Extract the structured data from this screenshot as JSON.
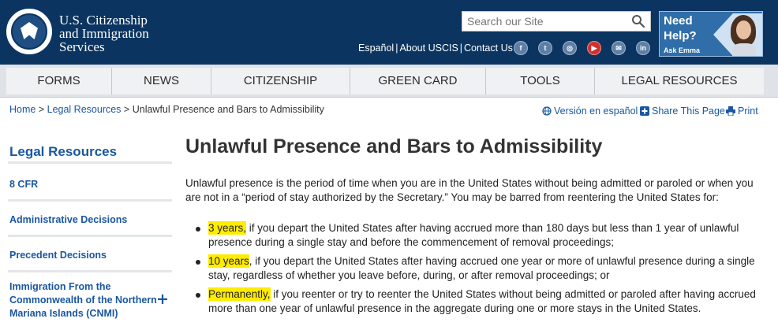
{
  "header": {
    "agency_line1": "U.S. Citizenship",
    "agency_line2": "and Immigration",
    "agency_line3": "Services",
    "search_placeholder": "Search our Site",
    "util_links": [
      "Español",
      "About USCIS",
      "Contact Us"
    ],
    "util_separator": "|",
    "social_icons": [
      "facebook-icon",
      "twitter-icon",
      "instagram-icon",
      "youtube-icon",
      "email-icon",
      "linkedin-icon"
    ],
    "need_help_line1": "Need",
    "need_help_line2": "Help?",
    "ask_emma": "Ask Emma"
  },
  "nav": {
    "items": [
      "FORMS",
      "NEWS",
      "CITIZENSHIP",
      "GREEN CARD",
      "TOOLS",
      "LEGAL RESOURCES"
    ]
  },
  "breadcrumb": {
    "home": "Home",
    "sep": ">",
    "legal": "Legal Resources",
    "current": "Unlawful Presence and Bars to Admissibility"
  },
  "page_tools": {
    "spanish": "Versión en español",
    "share": "Share This Page",
    "print": "Print"
  },
  "sidebar": {
    "title": "Legal Resources",
    "items": [
      "8 CFR",
      "Administrative Decisions",
      "Precedent Decisions",
      "Immigration From the",
      "Commonwealth of the Northern",
      "Mariana Islands (CNMI)"
    ]
  },
  "main": {
    "title": "Unlawful Presence and Bars to Admissibility",
    "intro_line1": "Unlawful presence is the period of time when you are in the United States without being admitted or paroled or when you",
    "intro_line2": "are not in a “period of stay authorized by the Secretary.” You may be barred from reentering the United States for:",
    "bullets": [
      {
        "highlight": "3 years,",
        "text1": " if you depart the United States after having accrued more than 180 days but less than 1 year of unlawful",
        "text2": "presence during a single stay and before the commencement of removal proceedings;"
      },
      {
        "highlight": "10 years",
        "text1": ", if you depart the United States after having accrued one year or more of unlawful presence during a single",
        "text2": "stay, regardless of whether you leave before, during, or after removal proceedings; or"
      },
      {
        "highlight": "Permanently,",
        "text1": " if you reenter or try to reenter the United States without being admitted or paroled after having accrued",
        "text2": "more than one year of unlawful presence in the aggregate during one or more stays in the United States."
      }
    ]
  },
  "colors": {
    "header_bg": "#0b3560",
    "link_blue": "#1a57a0",
    "highlight_yellow": "#ffec00",
    "nav_bg": "#f0f1f3"
  }
}
